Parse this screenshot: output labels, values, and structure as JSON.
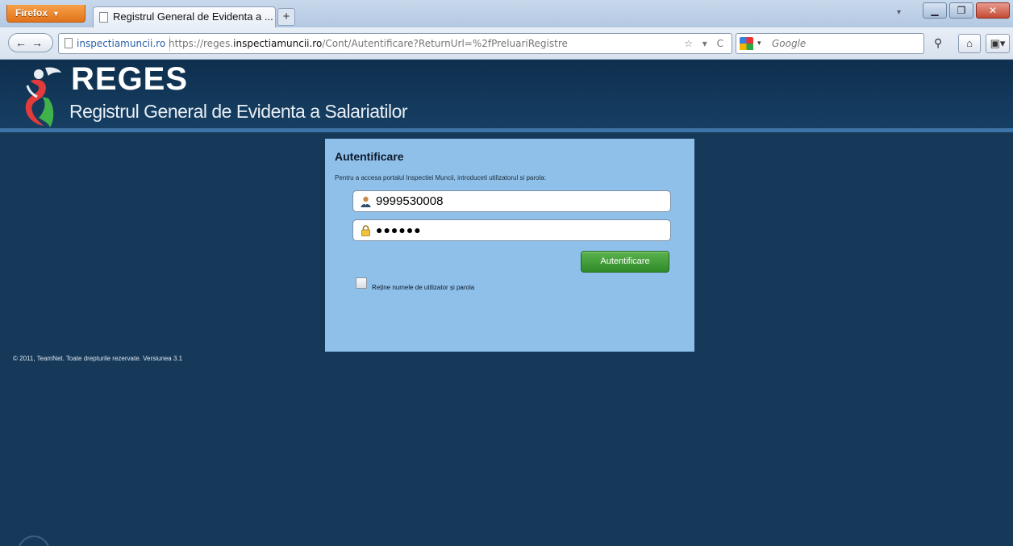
{
  "browser": {
    "menu_label": "Firefox",
    "menu_caret": "▼",
    "tab_title": "Registrul General de Evidenta a ...",
    "new_tab": "+",
    "tabs_arrow": "▾",
    "min": "▁",
    "max": "❐",
    "close": "✕",
    "back_forward": "←→",
    "site_identity": "inspectiamuncii.ro",
    "url_prefix": "https://reges.",
    "url_domain": "inspectiamuncii.ro",
    "url_rest": "/Cont/Autentificare?ReturnUrl=%2fPreluariRegistre",
    "url_icons": "☆ ▾ C",
    "search_caret": "▾",
    "search_placeholder": "Google",
    "search_go": "⚲",
    "home": "⌂",
    "tools": "▣▾"
  },
  "header": {
    "logo_title": "REGES",
    "logo_subtitle": "Registrul General de Evidenta a Salariatilor"
  },
  "login": {
    "title": "Autentificare",
    "intro": "Pentru a accesa portalul Inspectiei Muncii, introduceti utilizatorul si parola:",
    "username_value": "9999530008",
    "password_value": "●●●●●●",
    "submit_label": "Autentificare",
    "remember_label": "Reține numele de utilizator și parola"
  },
  "footer": {
    "text": "© 2011, TeamNet. Toate drepturile rezervate. Versiunea 3.1"
  },
  "colors": {
    "page_bg": "#16395a",
    "panel_bg": "#8fc0ea",
    "button_green": "#3c9a32",
    "header_accent": "#3e75a8"
  }
}
